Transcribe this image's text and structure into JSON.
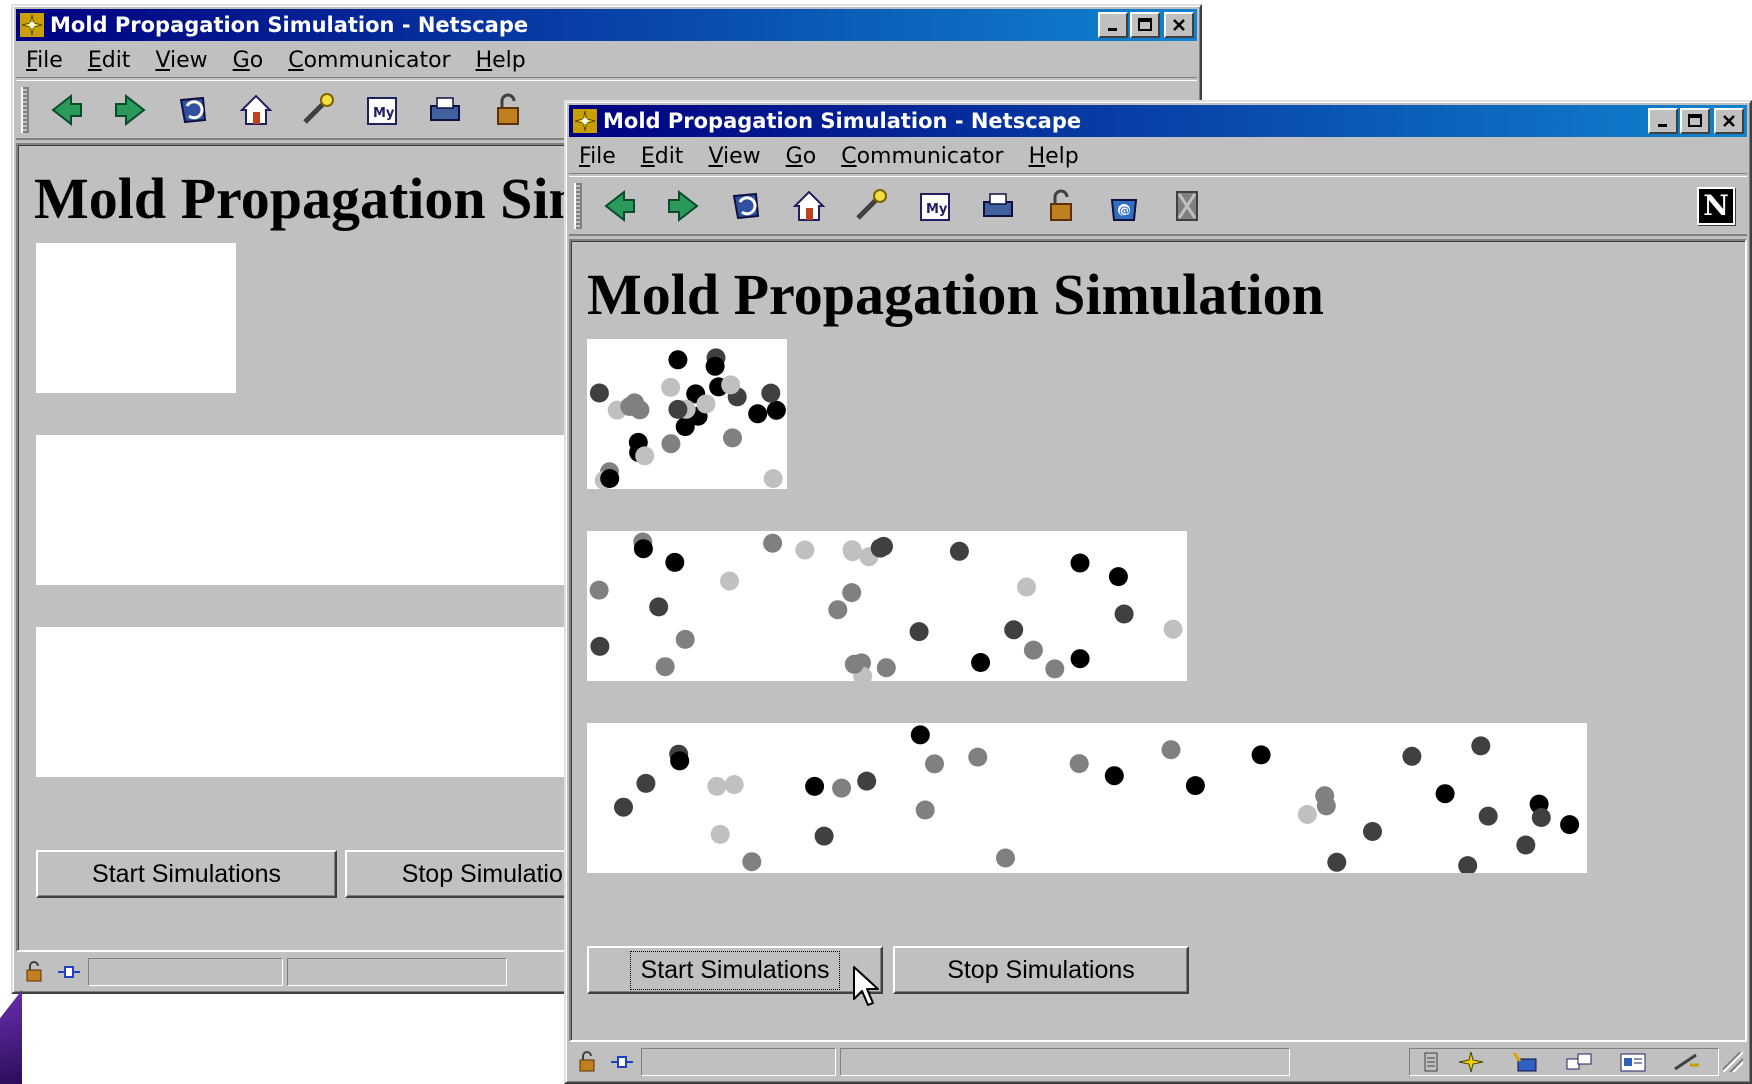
{
  "back_window": {
    "title": "Mold Propagation Simulation - Netscape",
    "menu": [
      {
        "accel": "F",
        "rest": "ile"
      },
      {
        "accel": "E",
        "rest": "dit"
      },
      {
        "accel": "V",
        "rest": "iew"
      },
      {
        "accel": "G",
        "rest": "o"
      },
      {
        "accel": "C",
        "rest": "ommunicator"
      },
      {
        "accel": "H",
        "rest": "elp"
      }
    ],
    "heading": "Mold Propagation Simulation",
    "start_label": "Start Simulations",
    "stop_label": "Stop Simulations"
  },
  "front_window": {
    "title": "Mold Propagation Simulation - Netscape",
    "menu": [
      {
        "accel": "F",
        "rest": "ile"
      },
      {
        "accel": "E",
        "rest": "dit"
      },
      {
        "accel": "V",
        "rest": "iew"
      },
      {
        "accel": "G",
        "rest": "o"
      },
      {
        "accel": "C",
        "rest": "ommunicator"
      },
      {
        "accel": "H",
        "rest": "elp"
      }
    ],
    "heading": "Mold Propagation Simulation",
    "start_label": "Start Simulations",
    "stop_label": "Stop Simulations",
    "netscape_logo": "N"
  },
  "toolbar_icons": [
    "back-icon",
    "forward-icon",
    "reload-icon",
    "home-icon",
    "search-icon",
    "my-netscape-icon",
    "print-icon",
    "security-icon",
    "shop-icon",
    "stop-icon"
  ],
  "spore_colors": [
    "#000000",
    "#404040",
    "#808080",
    "#c0c0c0"
  ]
}
